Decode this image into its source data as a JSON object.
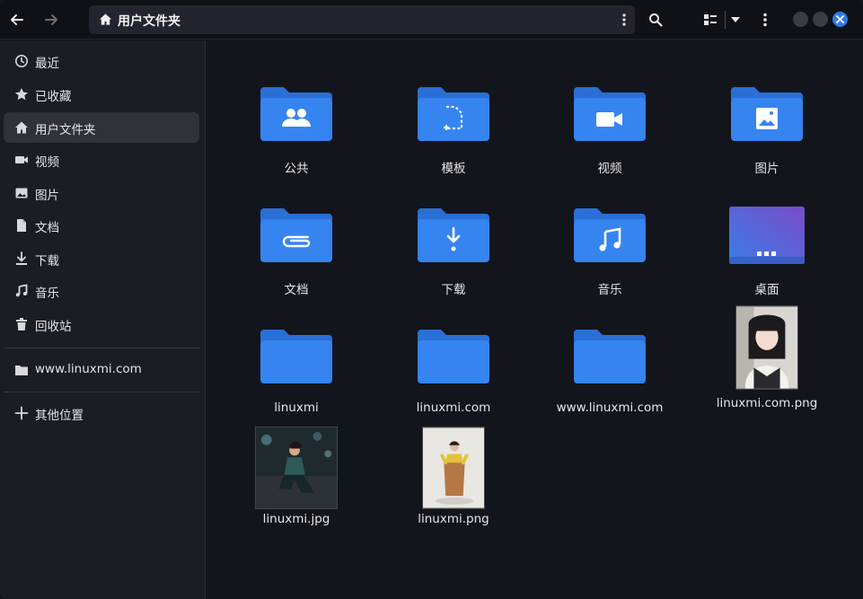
{
  "header": {
    "path_label": "用户文件夹",
    "icons": {
      "back": "arrow-left-icon",
      "forward": "arrow-right-icon",
      "home": "home-icon",
      "menu": "kebab-menu-icon",
      "search": "search-icon",
      "view": "list-view-icon",
      "view_dropdown": "chevron-down-icon",
      "app_menu": "kebab-menu-icon",
      "close": "close-icon"
    }
  },
  "sidebar": {
    "items": [
      {
        "label": "最近",
        "icon": "clock-icon"
      },
      {
        "label": "已收藏",
        "icon": "star-icon"
      },
      {
        "label": "用户文件夹",
        "icon": "home-icon"
      },
      {
        "label": "视频",
        "icon": "video-icon"
      },
      {
        "label": "图片",
        "icon": "image-icon"
      },
      {
        "label": "文档",
        "icon": "document-icon"
      },
      {
        "label": "下载",
        "icon": "download-icon"
      },
      {
        "label": "音乐",
        "icon": "music-icon"
      },
      {
        "label": "回收站",
        "icon": "trash-icon"
      }
    ],
    "bookmark": {
      "label": "www.linuxmi.com",
      "icon": "folder-icon"
    },
    "other": {
      "label": "其他位置",
      "icon": "plus-icon"
    }
  },
  "files": [
    {
      "label": "公共",
      "kind": "folder",
      "badge": "people-icon"
    },
    {
      "label": "模板",
      "kind": "folder",
      "badge": "template-icon"
    },
    {
      "label": "视频",
      "kind": "folder",
      "badge": "video-icon"
    },
    {
      "label": "图片",
      "kind": "folder",
      "badge": "image-icon"
    },
    {
      "label": "文档",
      "kind": "folder",
      "badge": "paperclip-icon"
    },
    {
      "label": "下载",
      "kind": "folder",
      "badge": "download-icon"
    },
    {
      "label": "音乐",
      "kind": "folder",
      "badge": "music-icon"
    },
    {
      "label": "桌面",
      "kind": "desktop",
      "badge": "desktop-icon"
    },
    {
      "label": "linuxmi",
      "kind": "folder",
      "badge": ""
    },
    {
      "label": "linuxmi.com",
      "kind": "folder",
      "badge": ""
    },
    {
      "label": "www.linuxmi.com",
      "kind": "folder",
      "badge": ""
    },
    {
      "label": "linuxmi.com.png",
      "kind": "image",
      "badge": "photo-thumbnail"
    },
    {
      "label": "linuxmi.jpg",
      "kind": "image",
      "badge": "photo-thumbnail"
    },
    {
      "label": "linuxmi.png",
      "kind": "image",
      "badge": "photo-thumbnail"
    }
  ],
  "colors": {
    "folder_blue": "#2f7be6",
    "folder_tab": "#2a6fd6",
    "accent": "#2f7be6"
  }
}
